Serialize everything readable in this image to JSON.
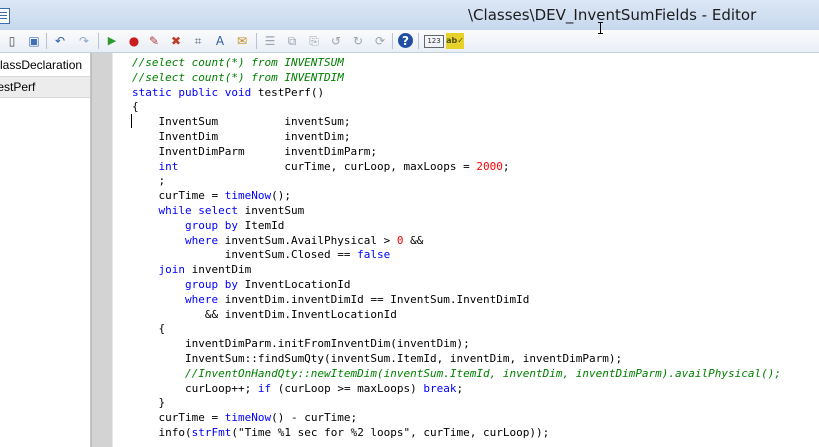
{
  "window": {
    "title": "\\Classes\\DEV_InventSumFields - Editor"
  },
  "toolbar": {
    "buttons": [
      {
        "name": "new-icon",
        "glyph": "▯",
        "color": "#4a4a4a"
      },
      {
        "name": "save-icon",
        "glyph": "▣",
        "color": "#3f6fb5"
      },
      {
        "name": "undo-icon",
        "glyph": "↶",
        "color": "#2d5da8"
      },
      {
        "name": "redo-icon",
        "glyph": "↷",
        "color": "#8da6c8"
      },
      {
        "name": "run-icon",
        "glyph": "▶",
        "color": "#2e9a2e"
      },
      {
        "name": "breakpoint-icon",
        "glyph": "●",
        "color": "#c81e1e"
      },
      {
        "name": "compile-icon",
        "glyph": "✎",
        "color": "#b23b3b"
      },
      {
        "name": "remove-breakpoints-icon",
        "glyph": "✖",
        "color": "#c0392b"
      },
      {
        "name": "lookup-icon",
        "glyph": "⌗",
        "color": "#5a6f8f"
      },
      {
        "name": "find-icon",
        "glyph": "A",
        "color": "#2d5da8"
      },
      {
        "name": "script-icon",
        "glyph": "✉",
        "color": "#c08a1e"
      },
      {
        "name": "list-icon",
        "glyph": "☰",
        "color": "#9aa4b1"
      },
      {
        "name": "copy-icon",
        "glyph": "⧉",
        "color": "#9aa4b1"
      },
      {
        "name": "paste-icon",
        "glyph": "⎘",
        "color": "#9aa4b1"
      },
      {
        "name": "go-back-icon",
        "glyph": "↺",
        "color": "#9aa4b1"
      },
      {
        "name": "go-forward-icon",
        "glyph": "↻",
        "color": "#9aa4b1"
      },
      {
        "name": "refresh-icon",
        "glyph": "⟳",
        "color": "#9aa4b1"
      },
      {
        "name": "help-icon",
        "glyph": "?",
        "color": "#ffffff"
      },
      {
        "name": "line-numbers-icon",
        "glyph": "123",
        "color": "#333333"
      },
      {
        "name": "spellcheck-icon",
        "glyph": "ab✓",
        "color": "#4f4f0f"
      }
    ]
  },
  "methods": [
    {
      "label": "classDeclaration",
      "selected": false
    },
    {
      "label": "testPerf",
      "selected": true
    }
  ],
  "code": [
    [
      {
        "t": "//select count(*) from INVENTSUM",
        "c": "cm"
      }
    ],
    [
      {
        "t": "//select count(*) from INVENTDIM",
        "c": "cm"
      }
    ],
    [
      {
        "t": "static public void ",
        "c": "kw"
      },
      {
        "t": "testPerf()",
        "c": ""
      }
    ],
    [
      {
        "t": "{",
        "c": ""
      }
    ],
    [
      {
        "t": "    InventSum          inventSum;",
        "c": ""
      }
    ],
    [
      {
        "t": "    InventDim          inventDim;",
        "c": ""
      }
    ],
    [
      {
        "t": "    InventDimParm      inventDimParm;",
        "c": ""
      }
    ],
    [
      {
        "t": "    int",
        "c": "kw"
      },
      {
        "t": "                curTime, curLoop, maxLoops = ",
        "c": ""
      },
      {
        "t": "2000",
        "c": "num"
      },
      {
        "t": ";",
        "c": ""
      }
    ],
    [
      {
        "t": "    ;",
        "c": ""
      }
    ],
    [
      {
        "t": "    curTime = ",
        "c": ""
      },
      {
        "t": "timeNow",
        "c": "kw"
      },
      {
        "t": "();",
        "c": ""
      }
    ],
    [
      {
        "t": "    while select ",
        "c": "kw"
      },
      {
        "t": "inventSum",
        "c": ""
      }
    ],
    [
      {
        "t": "        group by ",
        "c": "kw"
      },
      {
        "t": "ItemId",
        "c": ""
      }
    ],
    [
      {
        "t": "        where ",
        "c": "kw"
      },
      {
        "t": "inventSum.AvailPhysical > ",
        "c": ""
      },
      {
        "t": "0",
        "c": "num"
      },
      {
        "t": " &&",
        "c": ""
      }
    ],
    [
      {
        "t": "              inventSum.Closed == ",
        "c": ""
      },
      {
        "t": "false",
        "c": "kw"
      }
    ],
    [
      {
        "t": "    join ",
        "c": "kw"
      },
      {
        "t": "inventDim",
        "c": ""
      }
    ],
    [
      {
        "t": "        group by ",
        "c": "kw"
      },
      {
        "t": "InventLocationId",
        "c": ""
      }
    ],
    [
      {
        "t": "        where ",
        "c": "kw"
      },
      {
        "t": "inventDim.inventDimId == InventSum.InventDimId",
        "c": ""
      }
    ],
    [
      {
        "t": "           && inventDim.InventLocationId",
        "c": ""
      }
    ],
    [
      {
        "t": "    {",
        "c": ""
      }
    ],
    [
      {
        "t": "        inventDimParm.initFromInventDim(inventDim);",
        "c": ""
      }
    ],
    [
      {
        "t": "        InventSum::findSumQty(inventSum.ItemId, inventDim, inventDimParm);",
        "c": ""
      }
    ],
    [
      {
        "t": "        //InventOnHandQty::newItemDim(inventSum.ItemId, inventDim, inventDimParm).availPhysical();",
        "c": "cm"
      }
    ],
    [
      {
        "t": "        curLoop++; ",
        "c": ""
      },
      {
        "t": "if",
        "c": "kw"
      },
      {
        "t": " (curLoop >= maxLoops) ",
        "c": ""
      },
      {
        "t": "break",
        "c": "kw"
      },
      {
        "t": ";",
        "c": ""
      }
    ],
    [
      {
        "t": "    }",
        "c": ""
      }
    ],
    [
      {
        "t": "    curTime = ",
        "c": ""
      },
      {
        "t": "timeNow",
        "c": "kw"
      },
      {
        "t": "() - curTime;",
        "c": ""
      }
    ],
    [
      {
        "t": "    info(",
        "c": ""
      },
      {
        "t": "strFmt",
        "c": "kw"
      },
      {
        "t": "(\"Time %1 sec for %2 loops\", curTime, curLoop));",
        "c": ""
      }
    ]
  ]
}
